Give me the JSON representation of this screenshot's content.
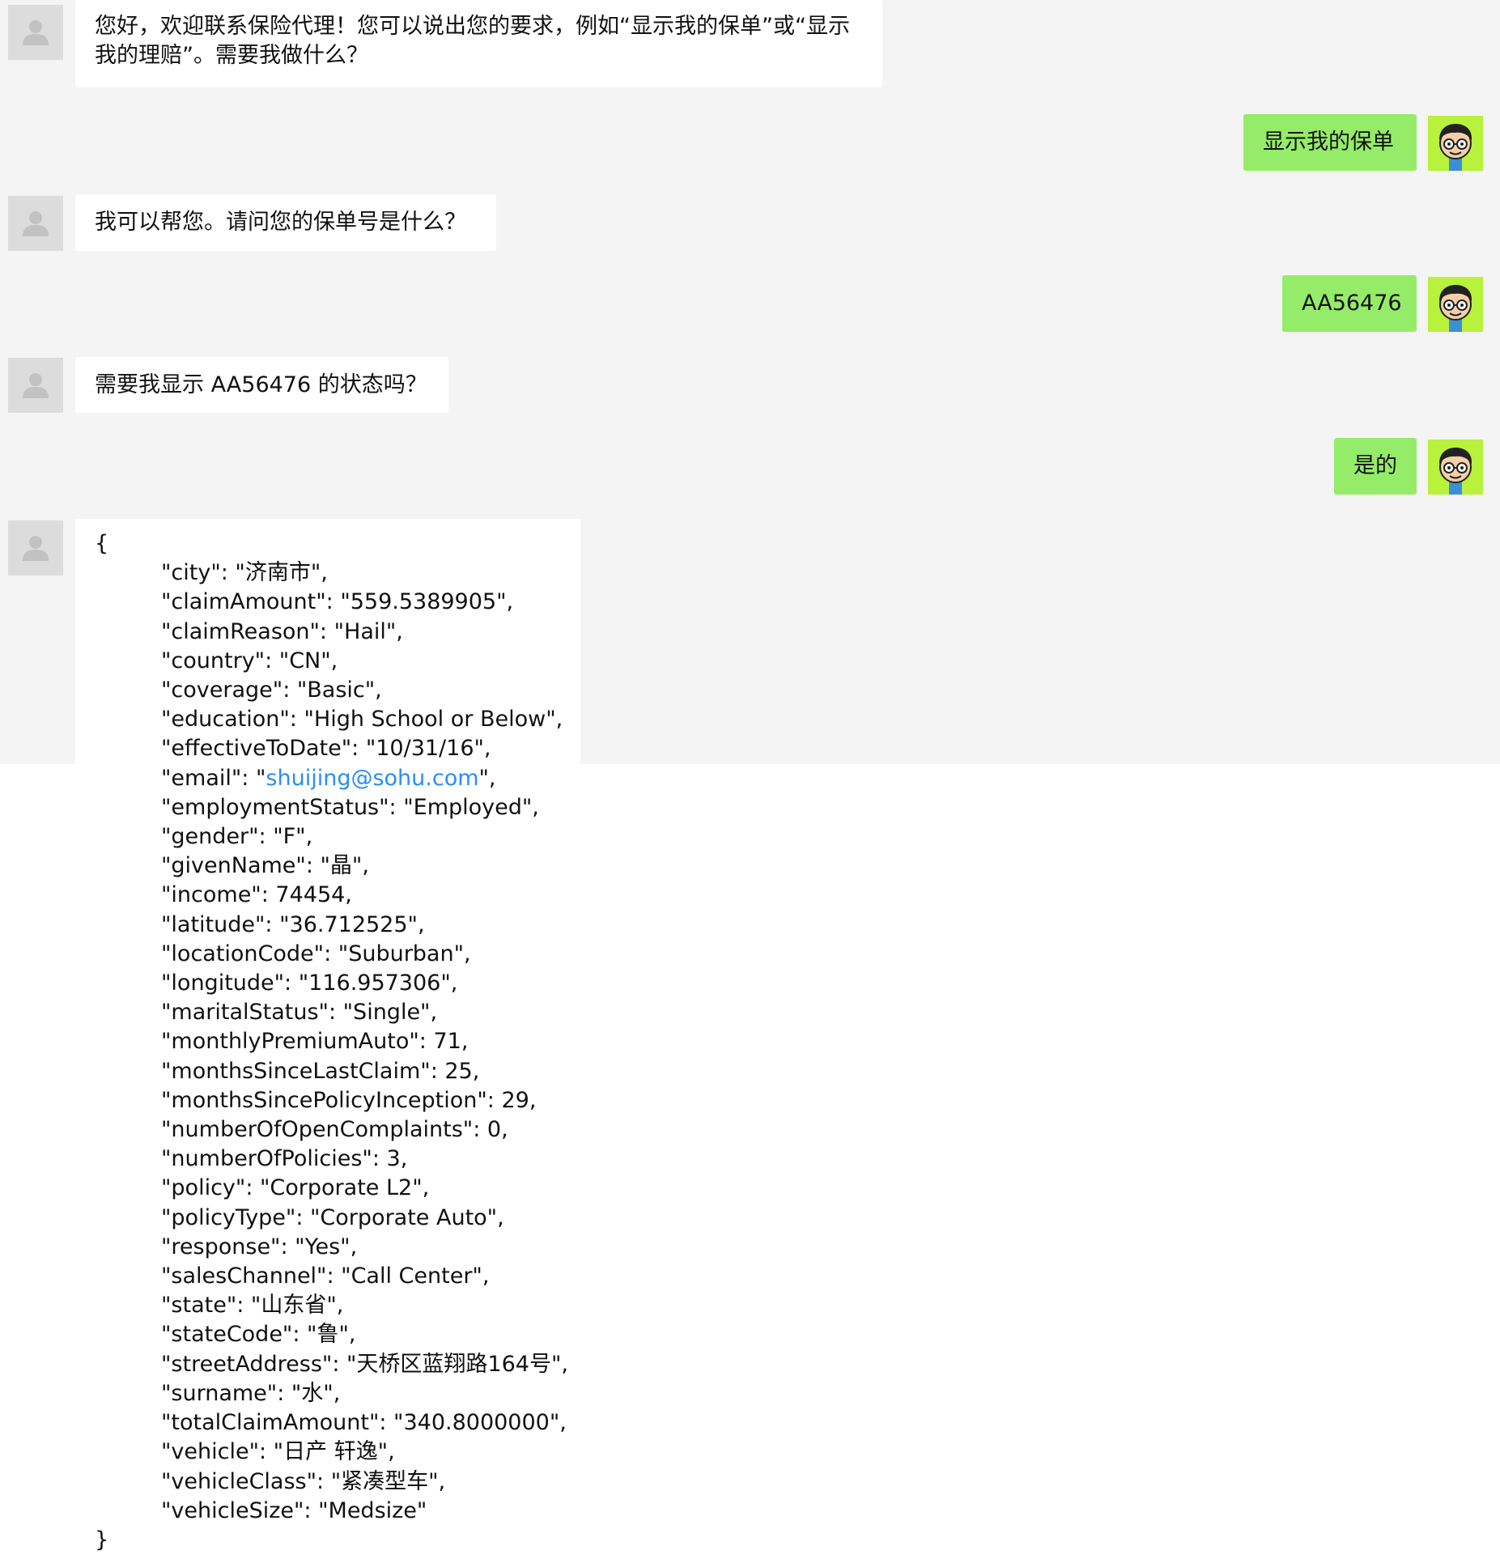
{
  "messages": {
    "m1": "您好，欢迎联系保险代理！您可以说出您的要求，例如“显示我的保单”或“显示我的理赔”。需要我做什么？",
    "m2": "显示我的保单",
    "m3": "我可以帮您。请问您的保单号是什么？",
    "m4": "AA56476",
    "m5": "需要我显示 AA56476 的状态吗？",
    "m6": "是的"
  },
  "json": {
    "open": "{",
    "close": "}",
    "rows": [
      {
        "key": "city",
        "text": "\"city\": \"济南市\","
      },
      {
        "key": "claimAmount",
        "text": "\"claimAmount\": \"559.5389905\","
      },
      {
        "key": "claimReason",
        "text": "\"claimReason\": \"Hail\","
      },
      {
        "key": "country",
        "text": "\"country\": \"CN\","
      },
      {
        "key": "coverage",
        "text": "\"coverage\": \"Basic\","
      },
      {
        "key": "education",
        "text": "\"education\": \"High School or Below\","
      },
      {
        "key": "effectiveToDate",
        "text": "\"effectiveToDate\": \"10/31/16\","
      },
      {
        "key": "email",
        "prefix": "\"email\": \"",
        "link": "shuijing@sohu.com",
        "suffix": "\","
      },
      {
        "key": "employmentStatus",
        "text": "\"employmentStatus\": \"Employed\","
      },
      {
        "key": "gender",
        "text": "\"gender\": \"F\","
      },
      {
        "key": "givenName",
        "text": "\"givenName\": \"晶\","
      },
      {
        "key": "income",
        "text": "\"income\": 74454,"
      },
      {
        "key": "latitude",
        "text": "\"latitude\": \"36.712525\","
      },
      {
        "key": "locationCode",
        "text": "\"locationCode\": \"Suburban\","
      },
      {
        "key": "longitude",
        "text": "\"longitude\": \"116.957306\","
      },
      {
        "key": "maritalStatus",
        "text": "\"maritalStatus\": \"Single\","
      },
      {
        "key": "monthlyPremiumAuto",
        "text": "\"monthlyPremiumAuto\": 71,"
      },
      {
        "key": "monthsSinceLastClaim",
        "text": "\"monthsSinceLastClaim\": 25,"
      },
      {
        "key": "monthsSincePolicyInception",
        "text": "\"monthsSincePolicyInception\": 29,"
      },
      {
        "key": "numberOfOpenComplaints",
        "text": "\"numberOfOpenComplaints\": 0,"
      },
      {
        "key": "numberOfPolicies",
        "text": "\"numberOfPolicies\": 3,"
      },
      {
        "key": "policy",
        "text": "\"policy\": \"Corporate L2\","
      },
      {
        "key": "policyType",
        "text": "\"policyType\": \"Corporate Auto\","
      },
      {
        "key": "response",
        "text": "\"response\": \"Yes\","
      },
      {
        "key": "salesChannel",
        "text": "\"salesChannel\": \"Call Center\","
      },
      {
        "key": "state",
        "text": "\"state\": \"山东省\","
      },
      {
        "key": "stateCode",
        "text": "\"stateCode\": \"鲁\","
      },
      {
        "key": "streetAddress",
        "text": "\"streetAddress\": \"天桥区蓝翔路164号\","
      },
      {
        "key": "surname",
        "text": "\"surname\": \"水\","
      },
      {
        "key": "totalClaimAmount",
        "text": "\"totalClaimAmount\": \"340.8000000\","
      },
      {
        "key": "vehicle",
        "text": "\"vehicle\": \"日产 轩逸\","
      },
      {
        "key": "vehicleClass",
        "text": "\"vehicleClass\": \"紧凑型车\","
      },
      {
        "key": "vehicleSize",
        "text": "\"vehicleSize\": \"Medsize\""
      }
    ]
  },
  "colors": {
    "background": "#f4f4f4",
    "bot_bubble": "#ffffff",
    "user_bubble": "#95ec69",
    "link": "#2a8ef2",
    "user_avatar_bg": "#b8f23c"
  }
}
